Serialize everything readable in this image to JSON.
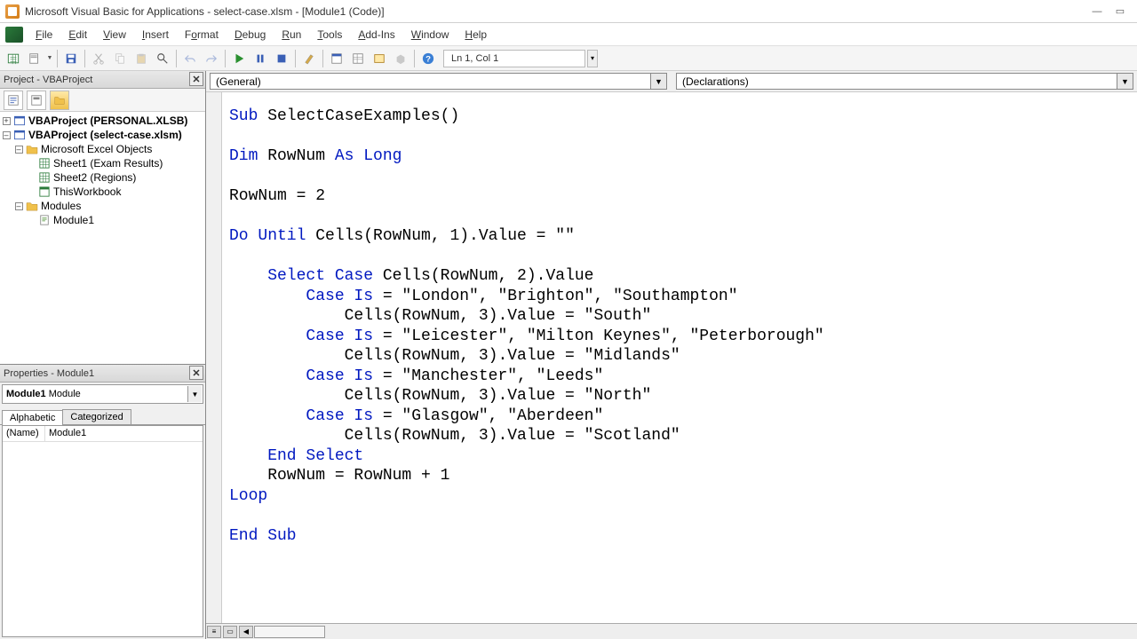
{
  "title": "Microsoft Visual Basic for Applications - select-case.xlsm - [Module1 (Code)]",
  "menu": {
    "file": "File",
    "edit": "Edit",
    "view": "View",
    "insert": "Insert",
    "format": "Format",
    "debug": "Debug",
    "run": "Run",
    "tools": "Tools",
    "addins": "Add-Ins",
    "window": "Window",
    "help": "Help"
  },
  "cursor": "Ln 1, Col 1",
  "project_panel_title": "Project - VBAProject",
  "tree": {
    "proj1": "VBAProject (PERSONAL.XLSB)",
    "proj2": "VBAProject (select-case.xlsm)",
    "folder_objects": "Microsoft Excel Objects",
    "sheet1": "Sheet1 (Exam Results)",
    "sheet2": "Sheet2 (Regions)",
    "thisworkbook": "ThisWorkbook",
    "folder_modules": "Modules",
    "module1": "Module1"
  },
  "props_panel_title": "Properties - Module1",
  "props_combo": {
    "name": "Module1",
    "type": "Module"
  },
  "tabs": {
    "alpha": "Alphabetic",
    "cat": "Categorized"
  },
  "prop": {
    "name_label": "(Name)",
    "name_value": "Module1"
  },
  "combo_left": "(General)",
  "combo_right": "(Declarations)",
  "code": {
    "l1a": "Sub",
    "l1b": " SelectCaseExamples()",
    "l2a": "Dim",
    "l2b": " RowNum ",
    "l2c": "As Long",
    "l3": "RowNum = 2",
    "l4a": "Do Until",
    "l4b": " Cells(RowNum, 1).Value = \"\"",
    "l5a": "    Select Case",
    "l5b": " Cells(RowNum, 2).Value",
    "l6a": "        Case Is",
    "l6b": " = \"London\", \"Brighton\", \"Southampton\"",
    "l7": "            Cells(RowNum, 3).Value = \"South\"",
    "l8a": "        Case Is",
    "l8b": " = \"Leicester\", \"Milton Keynes\", \"Peterborough\"",
    "l9": "            Cells(RowNum, 3).Value = \"Midlands\"",
    "l10a": "        Case Is",
    "l10b": " = \"Manchester\", \"Leeds\"",
    "l11": "            Cells(RowNum, 3).Value = \"North\"",
    "l12a": "        Case Is",
    "l12b": " = \"Glasgow\", \"Aberdeen\"",
    "l13": "            Cells(RowNum, 3).Value = \"Scotland\"",
    "l14": "    End Select",
    "l15": "    RowNum = RowNum + 1",
    "l16": "Loop",
    "l17": "End Sub"
  }
}
